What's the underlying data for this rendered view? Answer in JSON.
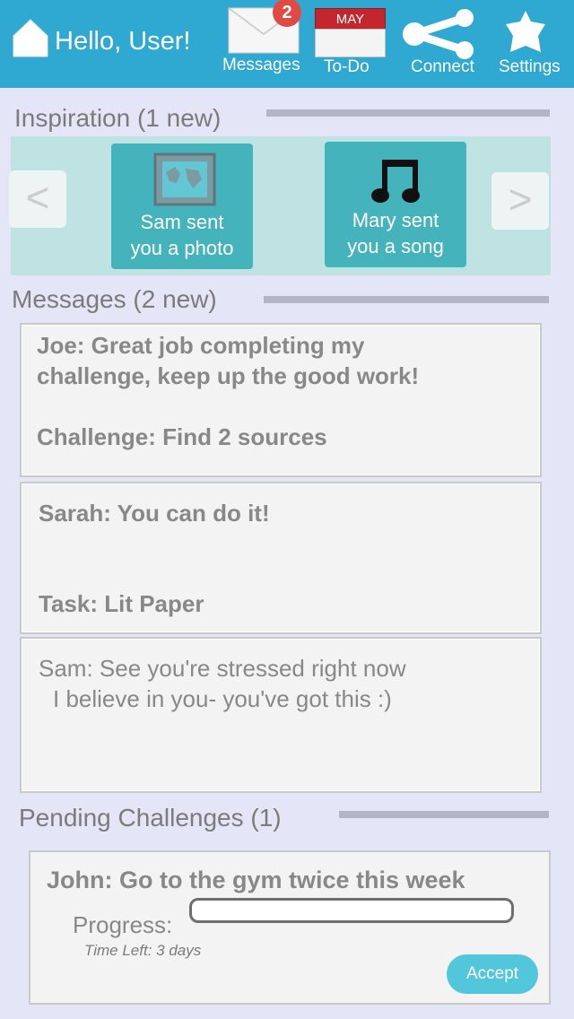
{
  "header": {
    "greeting": "Hello, User!",
    "nav": {
      "messages": {
        "label": "Messages",
        "badge": "2",
        "icon": "envelope-icon"
      },
      "todo": {
        "label": "To-Do",
        "month": "MAY",
        "icon": "calendar-icon"
      },
      "connect": {
        "label": "Connect",
        "icon": "share-icon"
      },
      "settings": {
        "label": "Settings",
        "icon": "gear-icon"
      }
    },
    "colors": {
      "bar": "#2fa8d2",
      "badge": "#e04a43"
    }
  },
  "inspiration": {
    "title": "Inspiration (1 new)",
    "prev": "<",
    "next": ">",
    "cards": [
      {
        "line1": "Sam sent",
        "line2": "you a photo",
        "icon": "photo-icon"
      },
      {
        "line1": "Mary sent",
        "line2": "you a song",
        "icon": "music-note-icon"
      }
    ]
  },
  "messages": {
    "title": "Messages (2 new)",
    "items": [
      {
        "line1": "Joe: Great job completing my",
        "line2": "challenge, keep up the good work!",
        "detail": "Challenge: Find 2 sources"
      },
      {
        "line1": "Sarah: You can do it!",
        "detail": "Task: Lit Paper"
      },
      {
        "line1": "Sam: See you're stressed right now",
        "line2": "I believe in you- you've got this :)"
      }
    ]
  },
  "challenges": {
    "title": "Pending Challenges (1)",
    "items": [
      {
        "title": "John: Go to the gym twice this week",
        "progress_label": "Progress:",
        "progress": 0,
        "time_left": "Time Left: 3 days",
        "accept": "Accept"
      }
    ]
  }
}
